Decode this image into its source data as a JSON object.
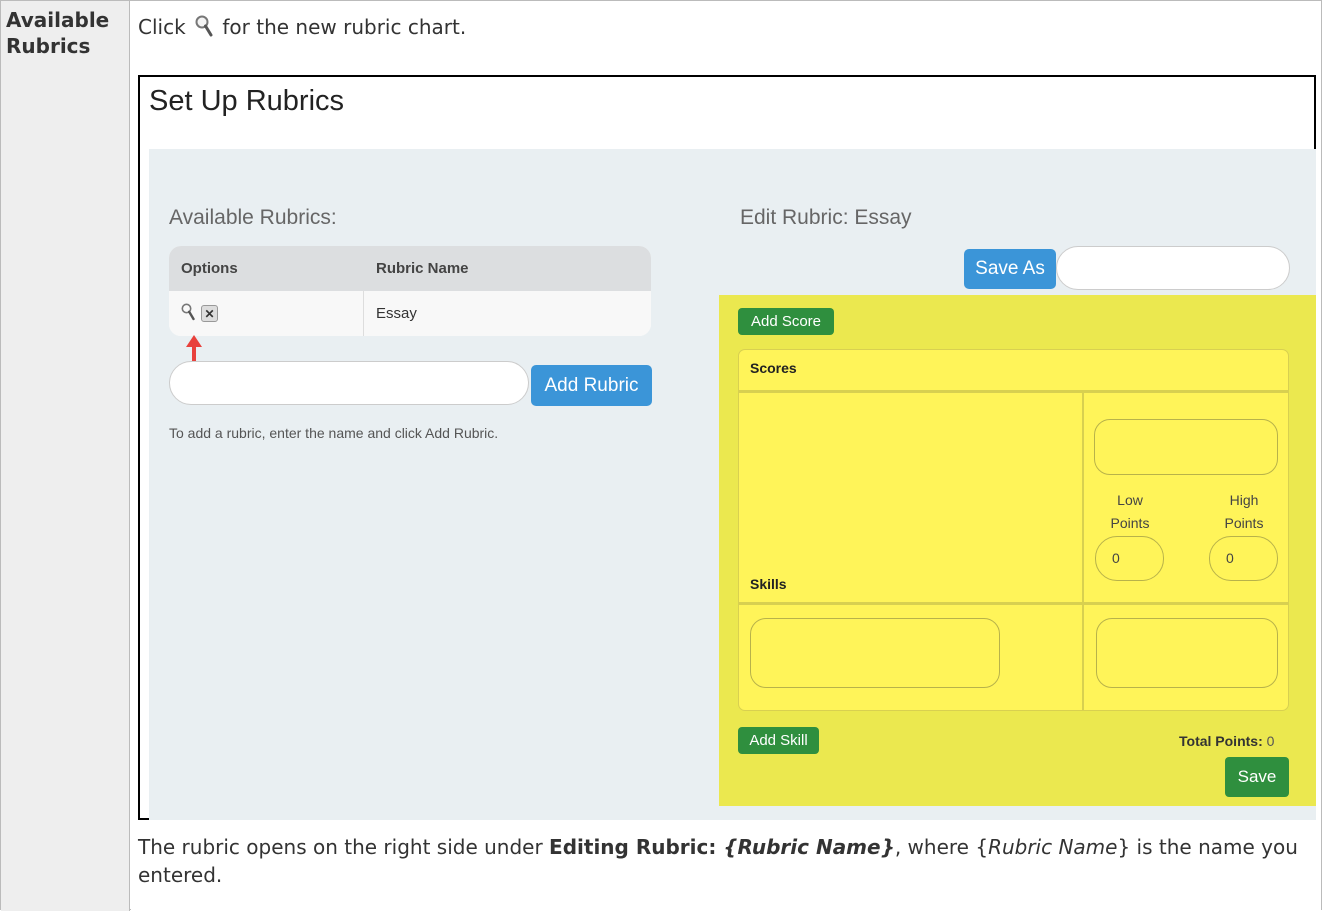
{
  "row_label": {
    "line1": "Available",
    "line2": "Rubrics"
  },
  "intro": {
    "before": "Click",
    "after": "for the new rubric chart."
  },
  "screenshot": {
    "title": "Set Up Rubrics",
    "left": {
      "heading": "Available Rubrics:",
      "columns": [
        "Options",
        "Rubric Name"
      ],
      "rows": [
        {
          "name": "Essay"
        }
      ],
      "add_rubric_label": "Add Rubric",
      "add_rubric_value": "",
      "hint": "To add a rubric, enter the name and click Add Rubric."
    },
    "right": {
      "heading": "Edit Rubric: Essay",
      "save_as_label": "Save As",
      "save_as_value": "",
      "add_score_label": "Add Score",
      "scores_label": "Scores",
      "skills_label": "Skills",
      "low_points_label": [
        "Low",
        "Points"
      ],
      "high_points_label": [
        "High",
        "Points"
      ],
      "low_points_value": "0",
      "high_points_value": "0",
      "add_skill_label": "Add Skill",
      "total_points_label": "Total Points:",
      "total_points_value": "0",
      "save_label": "Save"
    }
  },
  "footer": {
    "p1": "The rubric opens on the right side under ",
    "bold": "Editing Rubric: ",
    "bold_italic": "{Rubric Name}",
    "p2": ", where {",
    "italic": "Rubric Name",
    "p3": "} is the name you entered."
  },
  "colors": {
    "button_blue": "#3b95d8",
    "button_green": "#2f8f3e",
    "panel_yellow": "#ebe84f",
    "arrow_red": "#e8413c"
  },
  "icons": [
    "magnifier-icon",
    "delete-x-icon",
    "red-up-arrow-icon"
  ]
}
